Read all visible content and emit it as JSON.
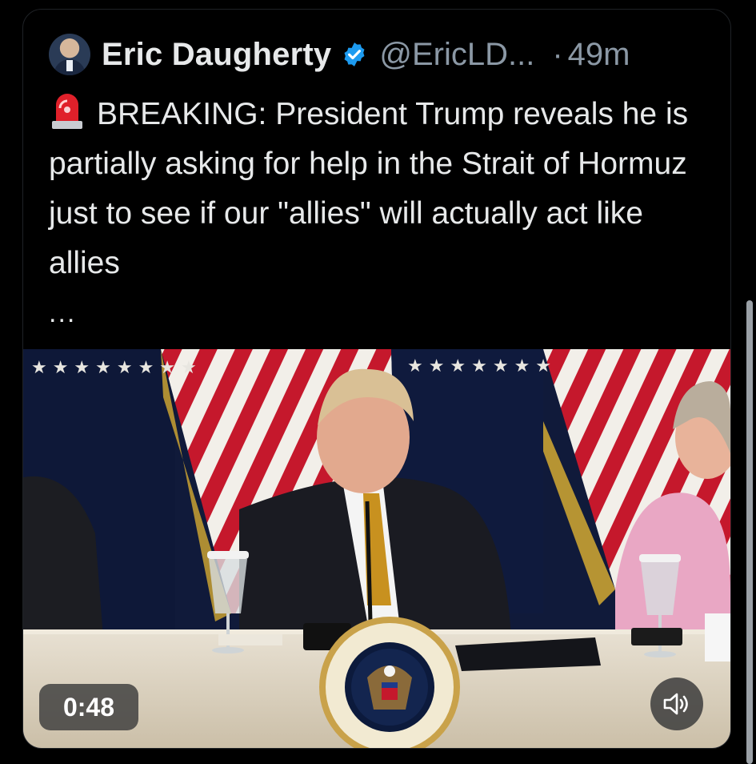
{
  "tweet": {
    "author_name": "Eric Daugherty",
    "author_handle": "@EricLD...",
    "separator": "·",
    "time_ago": "49m",
    "text": "BREAKING: President Trump reveals he is partially asking for help in the Strait of Hormuz just to see if our \"allies\" will actually act like allies",
    "truncation": "...",
    "icons": {
      "avatar": "avatar",
      "verified": "verified-badge-icon",
      "siren": "siren-icon",
      "volume": "volume-icon"
    },
    "colors": {
      "background": "#000000",
      "text": "#e7e9ea",
      "muted": "#8b98a5",
      "verified": "#1d9bf0"
    }
  },
  "video": {
    "duration_label": "0:48",
    "seal_text": "SEAL OF THE PRESIDENT OF THE UNITED STATES"
  }
}
